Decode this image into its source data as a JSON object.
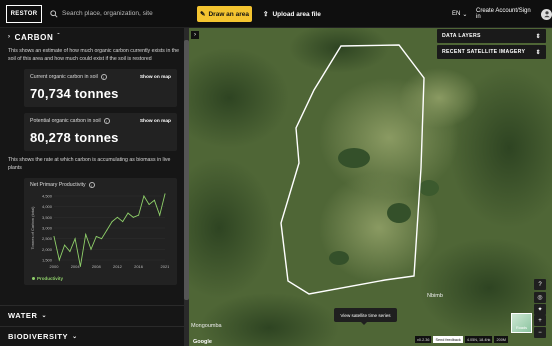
{
  "header": {
    "logo_text": "RESTOR",
    "search_placeholder": "Search place, organization, site",
    "draw_label": "Draw an area",
    "upload_label": "Upload area file",
    "language": "EN",
    "account_label": "Create Account/Sign in"
  },
  "sidebar": {
    "carbon_title": "CARBON",
    "carbon_desc": "This shows an estimate of how much organic carbon currently exists in the soil of this area and how much could exist if the soil is restored",
    "current_card": {
      "label": "Current organic carbon in soil",
      "action": "Show on map",
      "value": "70,734 tonnes"
    },
    "potential_card": {
      "label": "Potential organic carbon in soil",
      "action": "Show on map",
      "value": "80,278 tonnes"
    },
    "biomass_desc": "This shows the rate at which carbon is accumulating as biomass in live plants",
    "npp_title": "Net Primary Productivity",
    "legend_label": "Productivity",
    "water_title": "WATER",
    "biodiversity_title": "BIODIVERSITY"
  },
  "chart_data": {
    "type": "line",
    "title": "Net Primary Productivity",
    "ylabel": "Tonnes of Carbon (total)",
    "xlabel": "",
    "x": [
      2000,
      2001,
      2002,
      2003,
      2004,
      2005,
      2006,
      2007,
      2008,
      2009,
      2010,
      2011,
      2012,
      2013,
      2014,
      2015,
      2016,
      2017,
      2018,
      2019,
      2020,
      2021
    ],
    "series": [
      {
        "name": "Productivity",
        "values": [
          2600,
          1500,
          2200,
          1900,
          2500,
          1200,
          2700,
          2000,
          2600,
          2500,
          2900,
          3300,
          3500,
          3300,
          3700,
          3500,
          3600,
          4500,
          4100,
          4300,
          3600,
          4600
        ]
      }
    ],
    "x_ticks": [
      "2000",
      "2004",
      "2008",
      "2012",
      "2016",
      "2021"
    ],
    "y_ticks": [
      "1,500",
      "2,000",
      "2,500",
      "3,000",
      "3,500",
      "4,000",
      "4,500"
    ],
    "ylim": [
      1500,
      4500
    ],
    "xlim": [
      2000,
      2021
    ],
    "line_color": "#8fd06a"
  },
  "map": {
    "data_layers": "DATA LAYERS",
    "imagery": "RECENT SATELLITE IMAGERY",
    "timeseries_btn": "View satellite time series",
    "place_1": "Nbimb",
    "place_2": "Mongoumba",
    "google": "Google",
    "roads_label": "Roads",
    "version": "v0.2.36",
    "feedback": "Send feedback",
    "coords": "4.05N, 18.4hk",
    "scale": "200M"
  }
}
